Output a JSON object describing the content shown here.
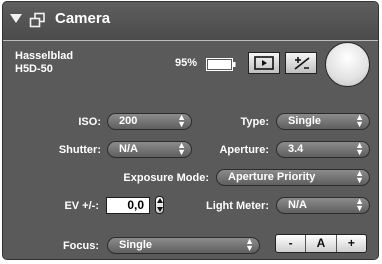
{
  "panel": {
    "title": "Camera"
  },
  "camera": {
    "model_line1": "Hasselblad",
    "model_line2": "H5D-50",
    "battery": "95%"
  },
  "fields": {
    "iso": {
      "label": "ISO:",
      "value": "200"
    },
    "type": {
      "label": "Type:",
      "value": "Single"
    },
    "shutter": {
      "label": "Shutter:",
      "value": "N/A"
    },
    "aperture": {
      "label": "Aperture:",
      "value": "3.4"
    },
    "exposure_mode": {
      "label": "Exposure Mode:",
      "value": "Aperture Priority"
    },
    "ev": {
      "label": "EV +/-:",
      "value": "0,0"
    },
    "light_meter": {
      "label": "Light Meter:",
      "value": "N/A"
    },
    "focus": {
      "label": "Focus:",
      "value": "Single"
    }
  },
  "focus_controls": {
    "minus": "-",
    "auto": "A",
    "plus": "+"
  },
  "icons": [
    "disclosure-triangle",
    "camera-window",
    "battery",
    "live-view",
    "exposure-tool",
    "shutter-release"
  ],
  "colors": {
    "panel_bg": "#5a5a5a",
    "header_bg": "#555555",
    "text": "#ffffff"
  }
}
